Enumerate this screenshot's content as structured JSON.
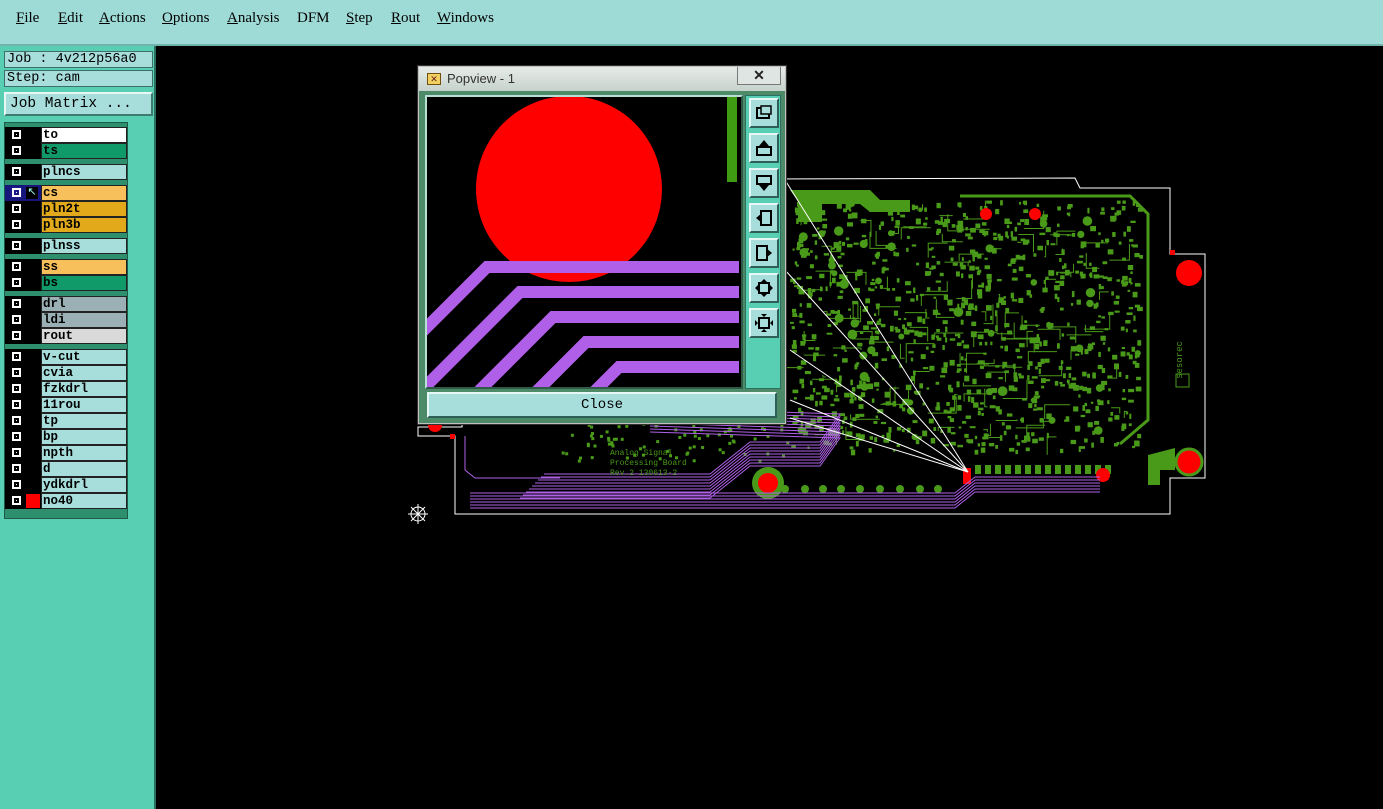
{
  "menu": [
    {
      "label": "File",
      "u": "F",
      "rest": "ile"
    },
    {
      "label": "Edit",
      "u": "E",
      "rest": "dit"
    },
    {
      "label": "Actions",
      "u": "A",
      "rest": "ctions"
    },
    {
      "label": "Options",
      "u": "O",
      "rest": "ptions"
    },
    {
      "label": "Analysis",
      "u": "A",
      "rest": "nalysis"
    },
    {
      "label": "DFM",
      "u": "",
      "rest": "DFM"
    },
    {
      "label": "Step",
      "u": "S",
      "rest": "tep"
    },
    {
      "label": "Rout",
      "u": "R",
      "rest": "out"
    },
    {
      "label": "Windows",
      "u": "W",
      "rest": "indows"
    }
  ],
  "job": {
    "label": "Job : 4v212p56a0",
    "step": "Step: cam",
    "matrix_button": "Job Matrix ..."
  },
  "layers": [
    {
      "name": "to",
      "color": "#ffffff"
    },
    {
      "name": "ts",
      "color": "#109a6a"
    },
    {
      "name": "plncs",
      "color": "#a7dedc"
    },
    {
      "name": "cs",
      "color": "#f8c05a",
      "selected": true
    },
    {
      "name": "pln2t",
      "color": "#e2aa1a"
    },
    {
      "name": "pln3b",
      "color": "#e2aa1a"
    },
    {
      "name": "plnss",
      "color": "#a7dedc"
    },
    {
      "name": "ss",
      "color": "#f8c05a"
    },
    {
      "name": "bs",
      "color": "#109a6a"
    },
    {
      "name": "drl",
      "color": "#9ab0b4"
    },
    {
      "name": "ldi",
      "color": "#9ab0b4"
    },
    {
      "name": "rout",
      "color": "#d9d9d9"
    },
    {
      "name": "v-cut",
      "color": "#a7dedc"
    },
    {
      "name": "cvia",
      "color": "#a7dedc"
    },
    {
      "name": "fzkdrl",
      "color": "#a7dedc"
    },
    {
      "name": "11rou",
      "color": "#a7dedc"
    },
    {
      "name": "tp",
      "color": "#a7dedc"
    },
    {
      "name": "bp",
      "color": "#a7dedc"
    },
    {
      "name": "npth",
      "color": "#a7dedc"
    },
    {
      "name": "d",
      "color": "#a7dedc"
    },
    {
      "name": "ydkdrl",
      "color": "#a7dedc"
    },
    {
      "name": "no40",
      "color": "#a7dedc",
      "red_marker": true
    }
  ],
  "popview": {
    "title": "Popview - 1",
    "close_x": "✕",
    "close_button": "Close"
  },
  "board": {
    "silk_lines": [
      "Analog Signal",
      "Processing Board",
      "Rev.2   130613-2"
    ],
    "side_text": "sesorec"
  },
  "colors": {
    "trace": "#4a9a1a",
    "pad": "#ff0000",
    "route": "#b060e8",
    "outline": "#ffffff"
  }
}
